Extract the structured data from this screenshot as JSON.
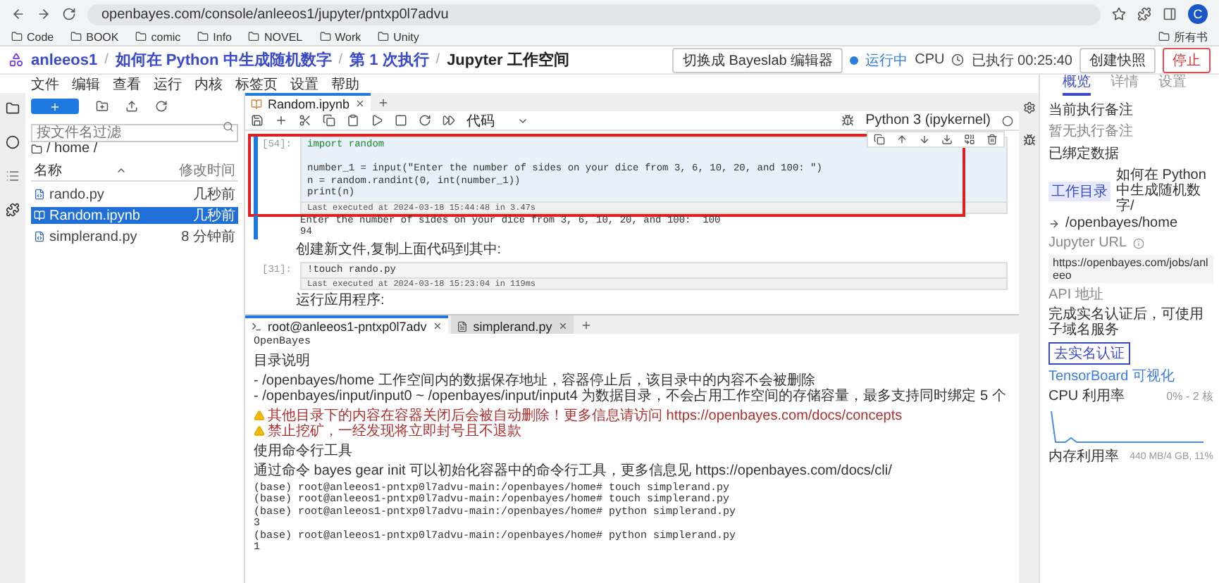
{
  "browser": {
    "url": "openbayes.com/console/anleeos1/jupyter/pntxp0l7advu",
    "profile": "C",
    "bookmarks": [
      "Code",
      "BOOK",
      "comic",
      "Info",
      "NOVEL",
      "Work",
      "Unity"
    ],
    "all_bookmarks": "所有书"
  },
  "header": {
    "breadcrumbs": [
      "anleeos1",
      "如何在 Python 中生成随机数字",
      "第 1 次执行"
    ],
    "separator": "/",
    "workspace": "Jupyter 工作空间",
    "switch_button": "切换成 Bayeslab 编辑器",
    "status": "运行中",
    "cpu": "CPU",
    "elapsed": "已执行 00:25:40",
    "snapshot_button": "创建快照",
    "stop_button": "停止"
  },
  "menu": [
    "文件",
    "编辑",
    "查看",
    "运行",
    "内核",
    "标签页",
    "设置",
    "帮助"
  ],
  "file_browser": {
    "search": {
      "placeholder": "按文件名过滤"
    },
    "path": "/ home /",
    "columns": [
      "名称",
      "修改时间"
    ],
    "files": [
      {
        "name": "rando.py",
        "modified": "几秒前",
        "kind": "python",
        "selected": false
      },
      {
        "name": "Random.ipynb",
        "modified": "几秒前",
        "kind": "notebook",
        "selected": true
      },
      {
        "name": "simplerand.py",
        "modified": "8 分钟前",
        "kind": "python",
        "selected": false
      }
    ]
  },
  "notebook": {
    "tabs": [
      {
        "label": "Random.ipynb",
        "selected": true
      }
    ],
    "cell_type": "代码",
    "kernel": "Python 3 (ipykernel)",
    "cells": [
      {
        "kind": "code",
        "prompt": "[54]:",
        "highlighted": true,
        "lines": [
          {
            "text": "import random",
            "spaced": false
          },
          {
            "text": "number_1 = input(\"Enter the number of sides on your dice from 3, 6, 10, 20, and 100: \")",
            "spaced": true
          },
          {
            "text": "n = random.randint(0, int(number_1))",
            "spaced": false
          },
          {
            "text": "print(n)",
            "spaced": false
          }
        ],
        "executed": "Last executed at 2024-03-18 15:44:48 in 3.47s",
        "output": [
          "Enter the number of sides on your dice from 3, 6, 10, 20, and 100:  100",
          "94"
        ]
      },
      {
        "kind": "markdown",
        "text": "创建新文件,复制上面代码到其中:"
      },
      {
        "kind": "code",
        "prompt": "[31]:",
        "highlighted": false,
        "lines": [
          {
            "text": "!touch rando.py",
            "spaced": false
          }
        ],
        "executed": "Last executed at 2024-03-18 15:23:04 in 119ms"
      },
      {
        "kind": "markdown",
        "text": "运行应用程序:"
      }
    ]
  },
  "terminal": {
    "tabs": [
      {
        "label": "root@anleeos1-pntxp0l7adv",
        "kind": "terminal",
        "selected": true
      },
      {
        "label": "simplerand.py",
        "kind": "file",
        "selected": false
      }
    ],
    "lines": [
      {
        "kind": "plain",
        "text": "OpenBayes",
        "spaced": false
      },
      {
        "kind": "plain",
        "text": "目录说明",
        "spaced": true
      },
      {
        "kind": "plain",
        "text": "- /openbayes/home 工作空间内的数据保存地址，容器停止后，该目录中的内容不会被删除",
        "spaced": true
      },
      {
        "kind": "plain",
        "text": "- /openbayes/input/input0 ~ /openbayes/input/input4 为数据目录，不会占用工作空间的存储容量，最多支持同时绑定 5 个",
        "spaced": false
      },
      {
        "kind": "warn",
        "text": "其他目录下的内容在容器关闭后会被自动删除！更多信息请访问 https://openbayes.com/docs/concepts",
        "spaced": true
      },
      {
        "kind": "warn",
        "text": "禁止挖矿，一经发现将立即封号且不退款",
        "spaced": false
      },
      {
        "kind": "plain",
        "text": "使用命令行工具",
        "spaced": true
      },
      {
        "kind": "plain",
        "text": "通过命令 bayes gear init 可以初始化容器中的命令行工具，更多信息见 https://openbayes.com/docs/cli/",
        "spaced": true
      },
      {
        "kind": "plain",
        "text": "(base) root@anleeos1-pntxp0l7advu-main:/openbayes/home# touch simplerand.py",
        "spaced": true
      },
      {
        "kind": "plain",
        "text": "(base) root@anleeos1-pntxp0l7advu-main:/openbayes/home# touch simplerand.py",
        "spaced": false
      },
      {
        "kind": "plain",
        "text": "(base) root@anleeos1-pntxp0l7advu-main:/openbayes/home# python simplerand.py",
        "spaced": false
      },
      {
        "kind": "plain",
        "text": "3",
        "spaced": false
      },
      {
        "kind": "plain",
        "text": "(base) root@anleeos1-pntxp0l7advu-main:/openbayes/home# python simplerand.py",
        "spaced": false
      },
      {
        "kind": "plain",
        "text": "1",
        "spaced": false
      }
    ]
  },
  "side_panel": {
    "tabs": [
      {
        "label": "概览",
        "selected": true
      },
      {
        "label": "详情",
        "selected": false
      },
      {
        "label": "设置",
        "selected": false
      }
    ],
    "note_title": "当前执行备注",
    "note": "暂无执行备注",
    "data_title": "已绑定数据",
    "data_tag": "工作目录",
    "data_name": "如何在 Python 中生成随机数字/",
    "data_path": "/openbayes/home",
    "url_title": "Jupyter URL",
    "url": "https://openbayes.com/jobs/anleeo",
    "api_title": "API 地址",
    "api_note": "完成实名认证后，可使用子域名服务",
    "verify_button": "去实名认证",
    "tensorboard": "TensorBoard 可视化",
    "cpu_title": "CPU 利用率",
    "cpu_value": "0% - 2 核",
    "memory_title": "内存利用率",
    "memory_value": "440 MB/4 GB, 11%"
  }
}
